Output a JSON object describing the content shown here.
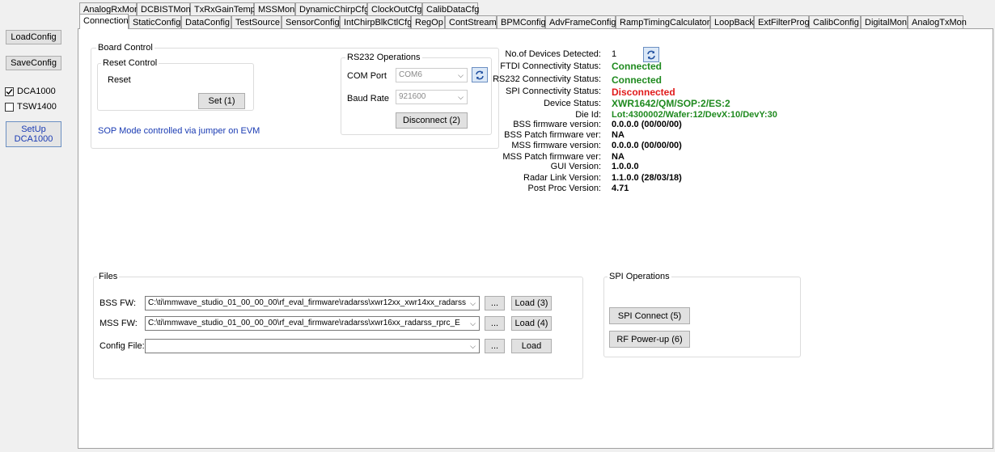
{
  "left": {
    "load_config": "LoadConfig",
    "save_config": "SaveConfig",
    "dca1000_label": "DCA1000",
    "tsw1400_label": "TSW1400",
    "setup_dca_line1": "SetUp",
    "setup_dca_line2": "DCA1000"
  },
  "tabs_row1": [
    "AnalogRxMon",
    "DCBISTMon",
    "TxRxGainTemp",
    "MSSMon",
    "DynamicChirpCfg",
    "ClockOutCfg",
    "CalibDataCfg"
  ],
  "tabs_row2": [
    "Connection",
    "StaticConfig",
    "DataConfig",
    "TestSource",
    "SensorConfig",
    "IntChirpBlkCtlCfg",
    "RegOp",
    "ContStream",
    "BPMConfig",
    "AdvFrameConfig",
    "RampTimingCalculator",
    "LoopBack",
    "ExtFilterProg",
    "CalibConfig",
    "DigitalMon",
    "AnalogTxMon"
  ],
  "board_control": {
    "title": "Board Control",
    "reset_title": "Reset Control",
    "reset_label": "Reset",
    "set_button": "Set (1)",
    "sop_text": "SOP Mode controlled via jumper on EVM"
  },
  "rs232": {
    "title": "RS232 Operations",
    "com_label": "COM Port",
    "com_value": "COM6",
    "baud_label": "Baud Rate",
    "baud_value": "921600",
    "disconnect_button": "Disconnect (2)"
  },
  "status": [
    {
      "label": "No.of Devices Detected:",
      "value": "1",
      "color": "#000000"
    },
    {
      "label": "FTDI Connectivity Status:",
      "value": "Connected",
      "color": "#1f8a1f"
    },
    {
      "label": "RS232 Connectivity Status:",
      "value": "Connected",
      "color": "#1f8a1f"
    },
    {
      "label": "SPI Connectivity Status:",
      "value": "Disconnected",
      "color": "#e01b1b"
    },
    {
      "label": "Device Status:",
      "value": "XWR1642/QM/SOP:2/ES:2",
      "color": "#1f8a1f"
    },
    {
      "label": "Die Id:",
      "value": "Lot:4300002/Wafer:12/DevX:10/DevY:30",
      "color": "#1f8a1f"
    },
    {
      "label": "BSS firmware version:",
      "value": "0.0.0.0 (00/00/00)",
      "color": "#000000"
    },
    {
      "label": "BSS Patch firmware ver:",
      "value": "NA",
      "color": "#000000"
    },
    {
      "label": "MSS firmware version:",
      "value": "0.0.0.0 (00/00/00)",
      "color": "#000000"
    },
    {
      "label": "MSS Patch firmware ver:",
      "value": "NA",
      "color": "#000000"
    },
    {
      "label": "GUI Version:",
      "value": "1.0.0.0",
      "color": "#000000"
    },
    {
      "label": "Radar Link Version:",
      "value": "1.1.0.0 (28/03/18)",
      "color": "#000000"
    },
    {
      "label": "Post Proc Version:",
      "value": "4.71",
      "color": "#000000"
    }
  ],
  "files": {
    "title": "Files",
    "bss_label": "BSS FW:",
    "bss_value": "C:\\ti\\mmwave_studio_01_00_00_00\\rf_eval_firmware\\radarss\\xwr12xx_xwr14xx_radarss",
    "mss_label": "MSS FW:",
    "mss_value": "C:\\ti\\mmwave_studio_01_00_00_00\\rf_eval_firmware\\radarss\\xwr16xx_radarss_rprc_E",
    "config_label": "Config File:",
    "config_value": "",
    "browse": "...",
    "load_bss": "Load (3)",
    "load_mss": "Load (4)",
    "load_config": "Load"
  },
  "spi": {
    "title": "SPI Operations",
    "connect_button": "SPI Connect (5)",
    "rf_power_button": "RF Power-up (6)"
  }
}
